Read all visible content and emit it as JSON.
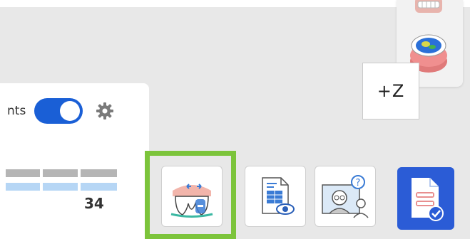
{
  "axis": {
    "label": "+Z"
  },
  "panel": {
    "toggle_label": "nts",
    "toggle_on": true,
    "number": "34"
  },
  "toolbar": {
    "tools": [
      {
        "name": "tooth-edit-tool",
        "selected": true
      },
      {
        "name": "report-view-tool",
        "selected": false
      },
      {
        "name": "consult-tool",
        "selected": false
      },
      {
        "name": "complete-case-tool",
        "selected": false
      }
    ]
  },
  "colors": {
    "accent_blue": "#1a5fd6",
    "highlight_green": "#7cc43b",
    "primary_button": "#2b5cd6"
  }
}
